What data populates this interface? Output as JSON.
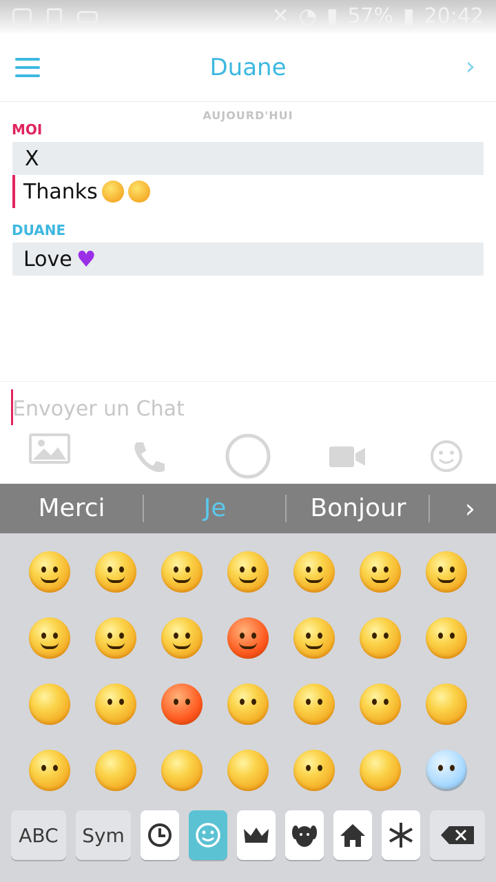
{
  "status": {
    "battery": "57%",
    "time": "20:42"
  },
  "header": {
    "title": "Duane"
  },
  "chat": {
    "day_label": "AUJOURD'HUI",
    "groups": [
      {
        "sender": "MOI",
        "color": "#e0245e",
        "messages": [
          "X",
          "Thanks"
        ]
      },
      {
        "sender": "DUANE",
        "color": "#3db8e0",
        "messages": [
          "Love"
        ]
      }
    ]
  },
  "input": {
    "placeholder": "Envoyer un Chat"
  },
  "suggestions": [
    "Merci",
    "Je",
    "Bonjour"
  ],
  "keyboard": {
    "abc_label": "ABC",
    "sym_label": "Sym",
    "categories": [
      "clock-icon",
      "smiley-icon",
      "crown-icon",
      "dog-icon",
      "house-icon",
      "snowflake-icon",
      "backspace-icon"
    ],
    "emoji_rows": [
      [
        "slight-smile",
        "blush",
        "grin-blush",
        "grin",
        "joy",
        "grin-eyes",
        "wink-tongue"
      ],
      [
        "sweat-smile",
        "laughing",
        "innocent",
        "devil",
        "wink",
        "hushed",
        "neutral"
      ],
      [
        "expressionless",
        "confused",
        "angry",
        "grimace",
        "anger",
        "cry",
        "sleepy"
      ],
      [
        "open-mouth",
        "persevere",
        "triumph",
        "disappointed-relieved",
        "worried",
        "steam",
        "scream"
      ]
    ]
  },
  "colors": {
    "accent": "#3db8e0",
    "me": "#e0245e",
    "suggest_bg": "#808080",
    "keyboard_bg": "#d4d6da",
    "active_tab": "#5bc2d4"
  }
}
